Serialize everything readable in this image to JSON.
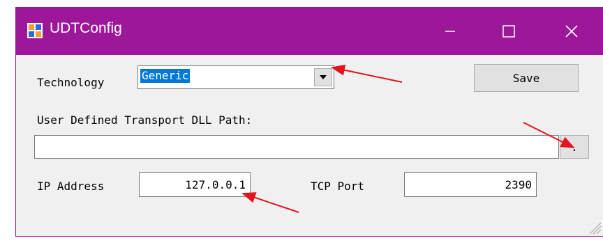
{
  "window": {
    "title": "UDTConfig",
    "accent": "#9d1799"
  },
  "technology": {
    "label": "Technology",
    "value": "Generic"
  },
  "save_label": "Save",
  "dll": {
    "label": "User Defined Transport DLL Path:",
    "value": "",
    "browse_label": "."
  },
  "ip": {
    "label": "IP Address",
    "value": "127.0.0.1"
  },
  "tcp": {
    "label": "TCP Port",
    "value": "2390"
  }
}
